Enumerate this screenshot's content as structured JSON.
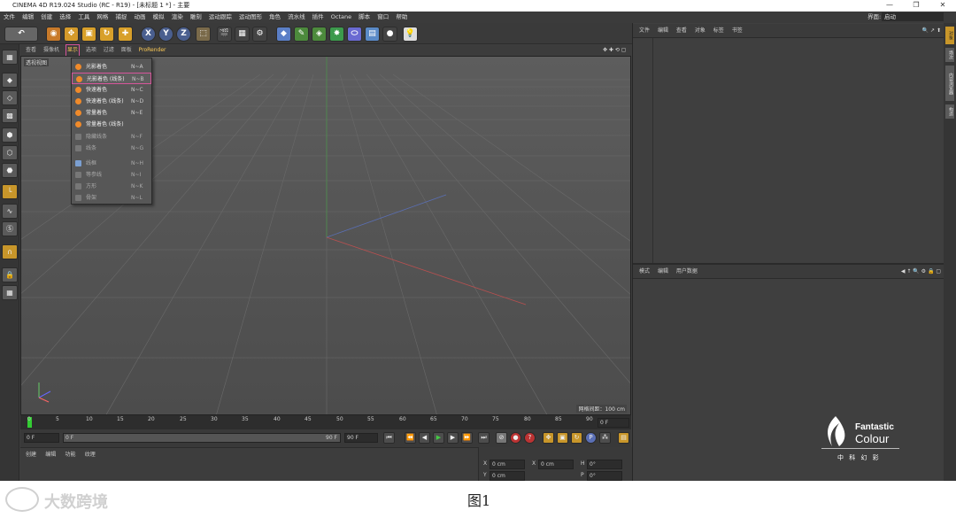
{
  "window": {
    "title": "CINEMA 4D R19.024 Studio (RC - R19) - [未标题 1 *] - 主要",
    "controls": [
      "—",
      "❐",
      "✕"
    ]
  },
  "menubar": {
    "items": [
      "文件",
      "编辑",
      "创建",
      "选择",
      "工具",
      "网格",
      "捕捉",
      "动画",
      "模拟",
      "渲染",
      "雕刻",
      "运动跟踪",
      "运动图形",
      "角色",
      "流水线",
      "插件",
      "Octane",
      "脚本",
      "窗口",
      "帮助"
    ],
    "layout_label": "界面:",
    "layout_value": "启动"
  },
  "toolbar": {
    "axis_x": "X",
    "axis_y": "Y",
    "axis_z": "Z"
  },
  "viewport_menu": {
    "items": [
      "查看",
      "摄像机",
      "显示",
      "选项",
      "过滤",
      "面板",
      "ProRender"
    ],
    "active_index": 2,
    "label": "透视视图",
    "grid_info": "网格间距：100 cm"
  },
  "display_menu": {
    "items": [
      {
        "label": "光影着色",
        "shortcut": "N~A",
        "icon": "shading-icon"
      },
      {
        "label": "光影着色 (线条)",
        "shortcut": "N~B",
        "icon": "shading-lines-icon",
        "selected": true
      },
      {
        "label": "快速着色",
        "shortcut": "N~C",
        "icon": "quick-shading-icon"
      },
      {
        "label": "快速着色 (线条)",
        "shortcut": "N~D",
        "icon": "quick-shading-lines-icon"
      },
      {
        "label": "常量着色",
        "shortcut": "N~E",
        "icon": "constant-shading-icon"
      },
      {
        "label": "常量着色 (线条)",
        "shortcut": "",
        "icon": "constant-shading-lines-icon"
      },
      {
        "label": "隐藏线条",
        "shortcut": "N~F",
        "icon": "hidden-lines-icon",
        "dim": true
      },
      {
        "label": "线条",
        "shortcut": "N~G",
        "icon": "lines-icon",
        "dim": true
      },
      {
        "label": "线框",
        "shortcut": "N~H",
        "icon": "wireframe-icon",
        "dim": true
      },
      {
        "label": "等参线",
        "shortcut": "N~I",
        "icon": "isoparms-icon",
        "dim": true
      },
      {
        "label": "方形",
        "shortcut": "N~K",
        "icon": "box-icon",
        "dim": true
      },
      {
        "label": "骨架",
        "shortcut": "N~L",
        "icon": "skeleton-icon",
        "dim": true
      }
    ]
  },
  "timeline": {
    "ticks": [
      "0",
      "5",
      "10",
      "15",
      "20",
      "25",
      "30",
      "35",
      "40",
      "45",
      "50",
      "55",
      "60",
      "65",
      "70",
      "75",
      "80",
      "85",
      "90"
    ],
    "current_frame": "0 F"
  },
  "playbar": {
    "start": "0 F",
    "range_start": "0 F",
    "range_end": "90 F",
    "end": "90 F"
  },
  "material_panel": {
    "tabs": [
      "创建",
      "编辑",
      "功能",
      "纹理"
    ]
  },
  "coords": {
    "x": "0 cm",
    "y": "0 cm",
    "z": "0 cm",
    "h": "0°",
    "p": "0°",
    "b": "0°"
  },
  "object_manager": {
    "tabs": [
      "文件",
      "编辑",
      "查看",
      "对象",
      "标签",
      "书签"
    ]
  },
  "attribute_manager": {
    "tabs": [
      "模式",
      "编辑",
      "用户数据"
    ]
  },
  "side_tabs": [
    "对象",
    "场次",
    "内容浏览器",
    "构造"
  ],
  "logo": {
    "brand1": "Fantastic",
    "brand2": "Colour",
    "chinese": "中 科 幻 彩"
  },
  "caption": {
    "text": "图1",
    "watermark": "大数跨境"
  }
}
